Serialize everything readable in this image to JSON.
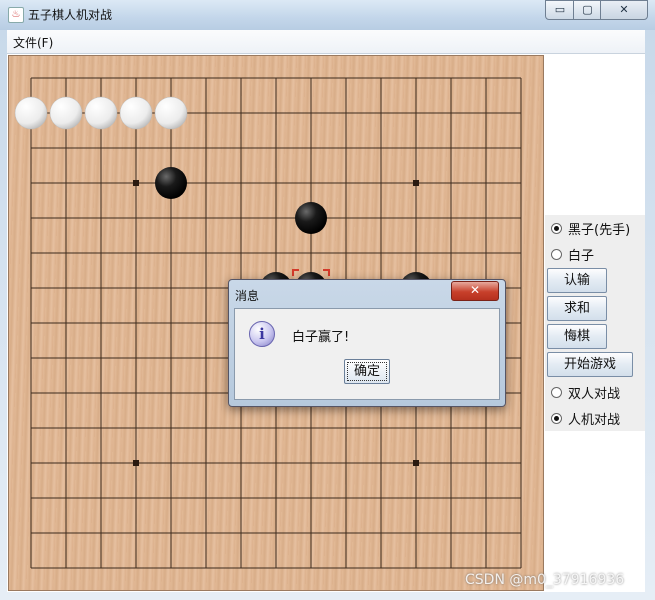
{
  "window": {
    "title": "五子棋人机对战",
    "controls": {
      "minimize": "▭",
      "maximize": "▢",
      "close": "✕"
    }
  },
  "menubar": {
    "file_label": "文件(F)"
  },
  "board": {
    "size": 15,
    "star_points": [
      [
        3,
        3
      ],
      [
        3,
        11
      ],
      [
        11,
        3
      ],
      [
        11,
        11
      ]
    ],
    "white_stones": [
      [
        0,
        1
      ],
      [
        1,
        1
      ],
      [
        2,
        1
      ],
      [
        3,
        1
      ],
      [
        4,
        1
      ]
    ],
    "black_stones": [
      [
        4,
        3
      ],
      [
        8,
        4
      ],
      [
        7,
        6
      ],
      [
        8,
        6
      ],
      [
        11,
        6
      ]
    ],
    "last_move": [
      8,
      6
    ],
    "colors": {
      "line": "#3c2a1c",
      "black": "#111111",
      "white": "#f4f4f4",
      "marker": "#d33a2a"
    }
  },
  "sidepanel": {
    "color_options": [
      {
        "label": "黑子(先手)",
        "selected": true
      },
      {
        "label": "白子",
        "selected": false
      }
    ],
    "buttons": {
      "resign": "认输",
      "draw": "求和",
      "undo": "悔棋",
      "start": "开始游戏"
    },
    "mode_options": [
      {
        "label": "双人对战",
        "selected": false
      },
      {
        "label": "人机对战",
        "selected": true
      }
    ]
  },
  "dialog": {
    "title": "消息",
    "icon": "info-icon",
    "message": "白子赢了!",
    "ok_label": "确定"
  },
  "watermark": "CSDN @m0_37916936"
}
